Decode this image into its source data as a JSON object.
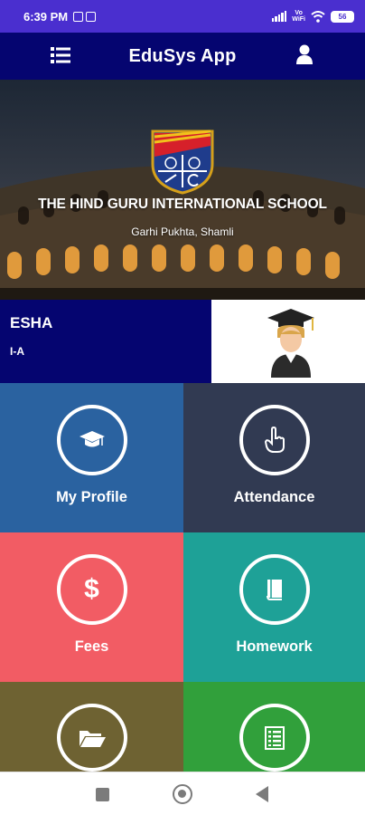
{
  "status_bar": {
    "time": "6:39 PM",
    "volte": "Vo\nWiFi",
    "battery": "56"
  },
  "app_bar": {
    "title": "EduSys App",
    "menu_icon": "list-menu-icon",
    "user_icon": "user-icon"
  },
  "school": {
    "name": "THE HIND GURU INTERNATIONAL SCHOOL",
    "location": "Garhi Pukhta, Shamli"
  },
  "student": {
    "name": "ESHA",
    "class": "I-A"
  },
  "tiles": [
    {
      "label": "My Profile",
      "icon": "graduation-cap-icon",
      "color": "#2a62a0"
    },
    {
      "label": "Attendance",
      "icon": "hand-pointer-icon",
      "color": "#313a52"
    },
    {
      "label": "Fees",
      "icon": "dollar-icon",
      "color": "#f25c64",
      "symbol": "$"
    },
    {
      "label": "Homework",
      "icon": "book-icon",
      "color": "#1ea197"
    },
    {
      "label": "",
      "icon": "folder-open-icon",
      "color": "#6e6232"
    },
    {
      "label": "",
      "icon": "list-sheet-icon",
      "color": "#31a03b"
    }
  ],
  "colors": {
    "status_bar": "#4a2fcf",
    "app_bar": "#050570",
    "student_band": "#050570"
  }
}
